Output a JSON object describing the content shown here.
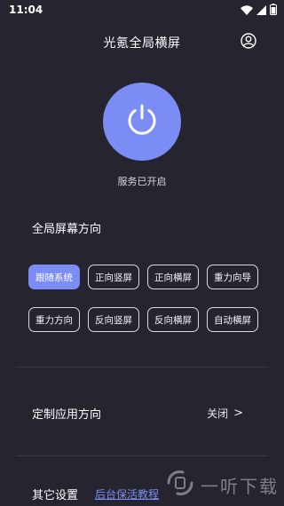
{
  "status_bar": {
    "time": "11:04",
    "icons": [
      "wifi-icon",
      "signal-icon",
      "battery-icon"
    ]
  },
  "header": {
    "title": "光氪全局横屏",
    "right_icon": "user-profile-icon"
  },
  "power": {
    "icon": "power-icon",
    "status_text": "服务已开启"
  },
  "global_orientation": {
    "title": "全局屏幕方向",
    "options": [
      {
        "label": "跟随系统",
        "selected": true
      },
      {
        "label": "正向竖屏",
        "selected": false
      },
      {
        "label": "正向横屏",
        "selected": false
      },
      {
        "label": "重力向导",
        "selected": false
      },
      {
        "label": "重力方向",
        "selected": false
      },
      {
        "label": "反向竖屏",
        "selected": false
      },
      {
        "label": "反向横屏",
        "selected": false
      },
      {
        "label": "自动横屏",
        "selected": false
      }
    ]
  },
  "custom_app_orientation": {
    "label": "定制应用方向",
    "value": "关闭",
    "chevron": ">"
  },
  "other_settings": {
    "label": "其它设置",
    "link": "后台保活教程"
  },
  "watermark": {
    "text": "一听下载"
  },
  "colors": {
    "background": "#26242f",
    "accent": "#7b8cf5",
    "text": "#ffffff",
    "chip_border": "#d8d8e0"
  }
}
